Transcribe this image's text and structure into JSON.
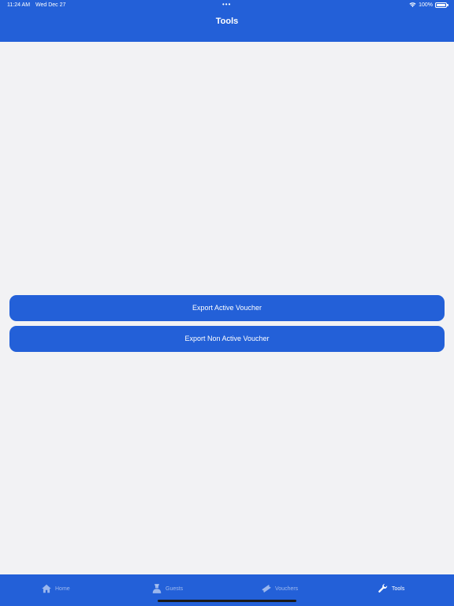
{
  "status_bar": {
    "time": "11:24 AM",
    "date": "Wed Dec 27",
    "dots": "•••",
    "battery": "100%"
  },
  "nav": {
    "title": "Tools"
  },
  "actions": {
    "export_active_label": "Export Active Voucher",
    "export_non_active_label": "Export Non Active Voucher"
  },
  "tabs": [
    {
      "label": "Home",
      "icon": "home-icon",
      "selected": false
    },
    {
      "label": "Guests",
      "icon": "guest-icon",
      "selected": false
    },
    {
      "label": "Vouchers",
      "icon": "ticket-icon",
      "selected": false
    },
    {
      "label": "Tools",
      "icon": "wrench-icon",
      "selected": true
    }
  ],
  "colors": {
    "accent": "#2360d8",
    "background": "#f2f2f4",
    "text_on_accent": "#ffffff"
  }
}
